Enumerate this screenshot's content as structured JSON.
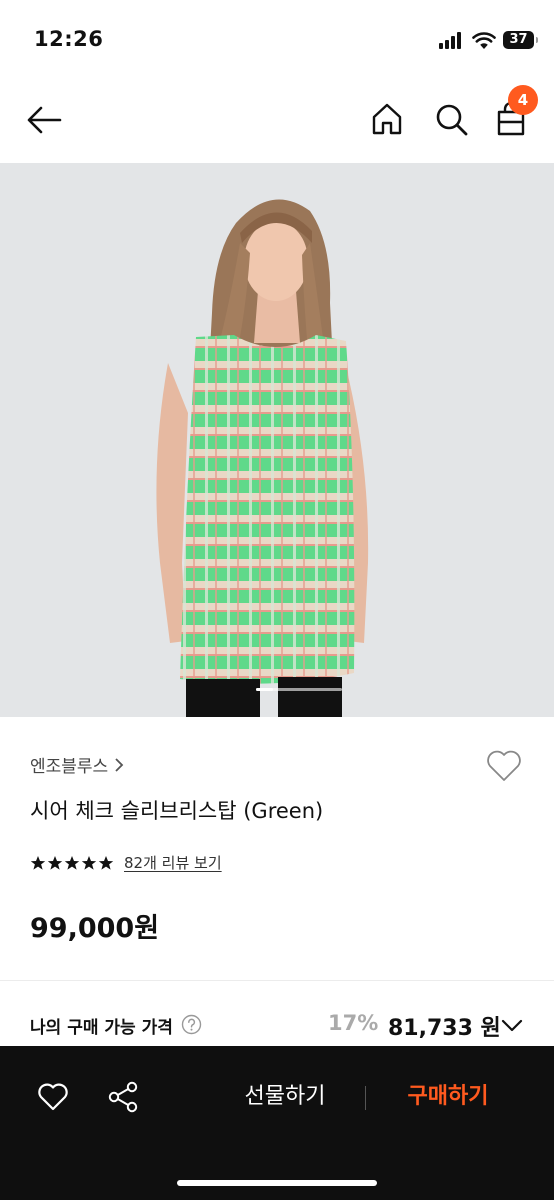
{
  "status_bar": {
    "time": "12:26",
    "battery": "37"
  },
  "nav": {
    "cart_count": "4"
  },
  "product": {
    "brand": "엔조블루스",
    "name": "시어 체크 슬리브리스탑 (Green)",
    "rating_stars": 5,
    "review_link": "82개 리뷰 보기",
    "price": "99,000원",
    "image_page_progress": 0.2
  },
  "my_price": {
    "label": "나의 구매 가능 가격",
    "discount": "17%",
    "price": "81,733 원"
  },
  "bottom_bar": {
    "gift_label": "선물하기",
    "buy_label": "구매하기"
  },
  "colors": {
    "accent": "#ff5a1f",
    "garment_green": "#4fd27a",
    "bottom_bar": "#0f0f0f"
  },
  "icons": [
    "back-arrow-icon",
    "home-icon",
    "search-icon",
    "shopping-bag-icon",
    "heart-icon",
    "share-icon",
    "question-icon",
    "chevron-down-icon",
    "star-icon"
  ]
}
